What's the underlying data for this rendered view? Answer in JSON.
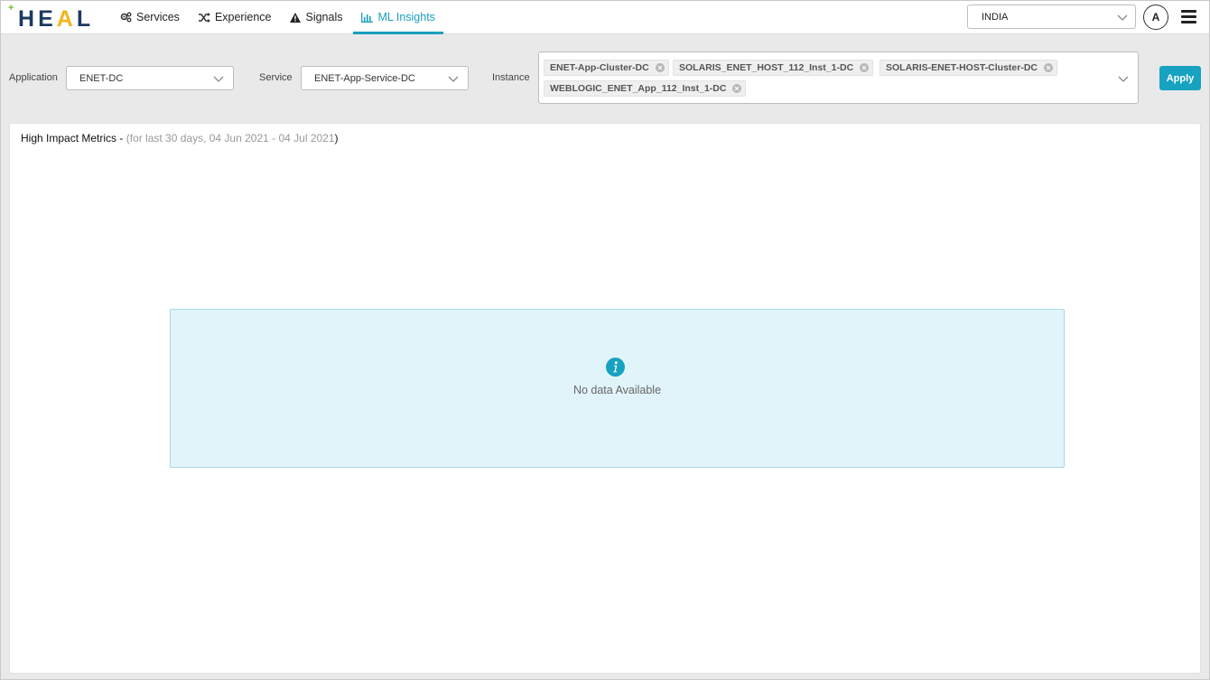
{
  "logo": {
    "plus": "+",
    "letters": [
      {
        "char": "H",
        "color": "#1c3a5e"
      },
      {
        "char": "E",
        "color": "#1c3a5e"
      },
      {
        "char": "A",
        "color": "#f2b51c"
      },
      {
        "char": "L",
        "color": "#1c3a5e"
      }
    ]
  },
  "nav": {
    "items": [
      {
        "label": "Services",
        "icon": "gears-icon"
      },
      {
        "label": "Experience",
        "icon": "shuffle-icon"
      },
      {
        "label": "Signals",
        "icon": "warning-icon"
      },
      {
        "label": "ML Insights",
        "icon": "bar-chart-icon",
        "active": true
      }
    ]
  },
  "header": {
    "account": "INDIA",
    "avatar_initial": "A"
  },
  "filters": {
    "application_label": "Application",
    "application_value": "ENET-DC",
    "service_label": "Service",
    "service_value": "ENET-App-Service-DC",
    "instance_label": "Instance",
    "instances": [
      "ENET-App-Cluster-DC",
      "SOLARIS_ENET_HOST_112_Inst_1-DC",
      "SOLARIS-ENET-HOST-Cluster-DC",
      "WEBLOGIC_ENET_App_112_Inst_1-DC"
    ],
    "apply_label": "Apply"
  },
  "panel": {
    "title": "High Impact Metrics - ",
    "subtitle_open": "(",
    "subtitle": "for last 30 days, 04 Jun 2021 - 04 Jul 2021",
    "subtitle_close": ")",
    "empty_message": "No data Available"
  },
  "colors": {
    "accent": "#16a2c0",
    "logo_navy": "#1c3a5e",
    "logo_yellow": "#f2b51c",
    "logo_green": "#6bbf3a",
    "info_bg": "#e1f4f9"
  }
}
